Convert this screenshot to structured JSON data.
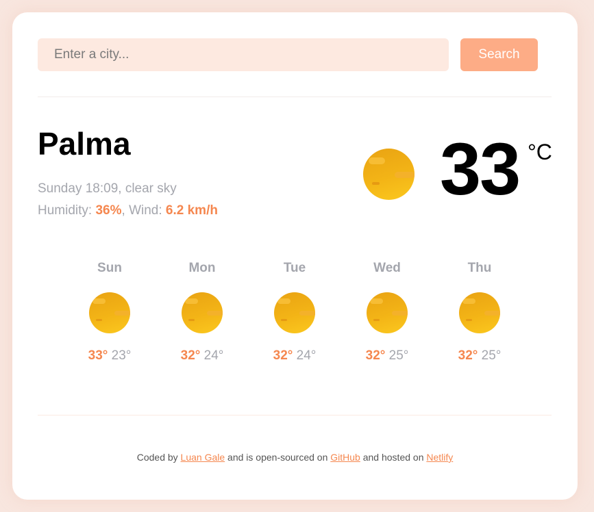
{
  "search": {
    "placeholder": "Enter a city...",
    "value": "",
    "button_label": "Search"
  },
  "current": {
    "city": "Palma",
    "date_time": "Sunday 18:09",
    "description": "clear sky",
    "humidity_label": "Humidity: ",
    "humidity": "36%",
    "wind_label": "Wind: ",
    "wind": "6.2 km/h",
    "temperature": "33",
    "unit": "°C",
    "icon": "sun-icon"
  },
  "forecast": [
    {
      "day": "Sun",
      "max": "33°",
      "min": "23°",
      "icon": "sun-icon"
    },
    {
      "day": "Mon",
      "max": "32°",
      "min": "24°",
      "icon": "sun-icon"
    },
    {
      "day": "Tue",
      "max": "32°",
      "min": "24°",
      "icon": "sun-icon"
    },
    {
      "day": "Wed",
      "max": "32°",
      "min": "25°",
      "icon": "sun-icon"
    },
    {
      "day": "Thu",
      "max": "32°",
      "min": "25°",
      "icon": "sun-icon"
    }
  ],
  "footer": {
    "text1": "Coded by ",
    "author": "Luan Gale",
    "text2": " and is open-sourced on ",
    "repo": "GitHub",
    "text3": " and hosted on ",
    "host": "Netlify"
  },
  "colors": {
    "accent": "#f5874f",
    "button": "#fdac86",
    "input_bg": "#fde9e0",
    "muted": "#a4a6ad",
    "page_bg": "#f8e6df"
  }
}
